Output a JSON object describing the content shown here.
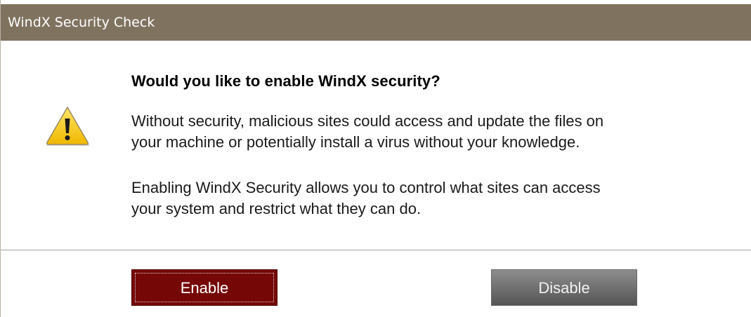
{
  "window": {
    "title": "WindX Security Check"
  },
  "dialog": {
    "icon": "warning-icon",
    "heading": "Would you like to enable WindX security?",
    "paragraph1": {
      "line1": "Without security, malicious sites could access and update the files on",
      "line2": "your machine or potentially install a virus without your knowledge."
    },
    "paragraph2": {
      "line1": "Enabling WindX Security allows you to control what sites can access",
      "line2": "your system and restrict what they can do."
    }
  },
  "buttons": {
    "enable_label": "Enable",
    "disable_label": "Disable"
  },
  "colors": {
    "titlebar": "#7f7360",
    "enable_button": "#760707",
    "disable_button": "#707070",
    "warning_yellow": "#f5c400"
  }
}
